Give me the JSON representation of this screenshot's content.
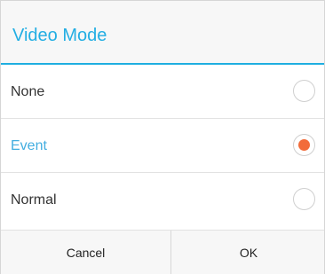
{
  "dialog": {
    "title": "Video Mode",
    "options": [
      {
        "label": "None",
        "selected": false
      },
      {
        "label": "Event",
        "selected": true
      },
      {
        "label": "Normal",
        "selected": false
      }
    ],
    "buttons": {
      "cancel": "Cancel",
      "ok": "OK"
    }
  },
  "colors": {
    "accent": "#23aee3",
    "selected_dot": "#f26c3a"
  }
}
